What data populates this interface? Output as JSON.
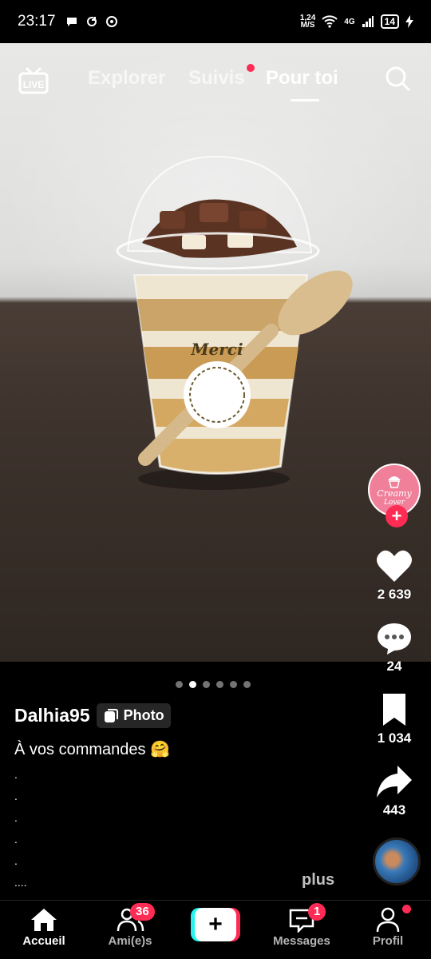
{
  "status_bar": {
    "time": "23:17",
    "speed_value": "1,24",
    "speed_unit": "M/S",
    "network": "4G",
    "battery": "14"
  },
  "top_nav": {
    "live_label": "LIVE",
    "tabs": [
      {
        "label": "Explorer",
        "active": false
      },
      {
        "label": "Suivis",
        "active": false,
        "has_dot": true
      },
      {
        "label": "Pour toi",
        "active": true
      }
    ]
  },
  "creator_avatar": {
    "text": "Creamy",
    "text2": "Lover"
  },
  "actions": {
    "likes": "2 639",
    "comments": "24",
    "saves": "1 034",
    "shares": "443"
  },
  "carousel": {
    "count": 6,
    "active_index": 1
  },
  "caption": {
    "author": "Dalhia95",
    "badge": "Photo",
    "description": "À vos commandes 🤗",
    "dots_lines": [
      ".",
      ".",
      ".",
      ".",
      ".",
      "...."
    ],
    "more": "plus"
  },
  "photo_sticker": "Merci",
  "bottom_nav": {
    "home": "Accueil",
    "friends": "Ami(e)s",
    "friends_badge": "36",
    "create": "+",
    "messages": "Messages",
    "messages_badge": "1",
    "profile": "Profil"
  },
  "colors": {
    "accent": "#fe2c55",
    "cyan": "#25f4ee"
  }
}
